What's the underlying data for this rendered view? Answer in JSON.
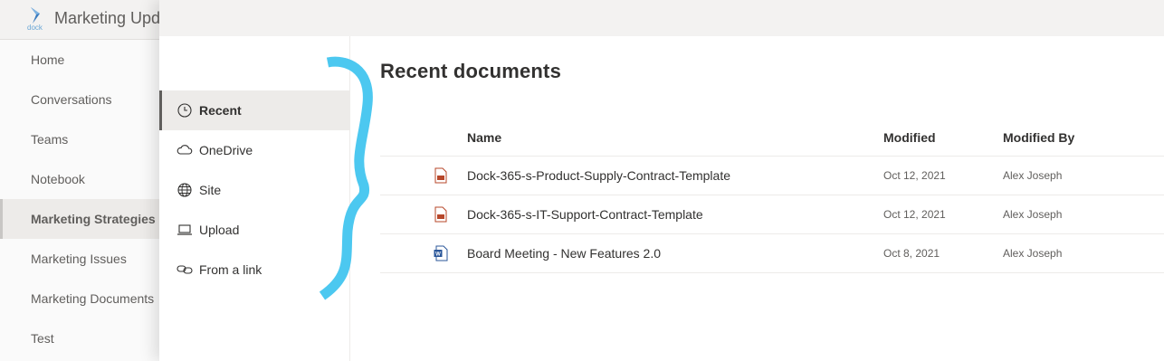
{
  "site": {
    "logo_text": "dock",
    "title": "Marketing Updates",
    "nav_items": [
      {
        "label": "Home"
      },
      {
        "label": "Conversations"
      },
      {
        "label": "Teams"
      },
      {
        "label": "Notebook"
      },
      {
        "label": "Marketing Strategies",
        "selected": true
      },
      {
        "label": "Marketing Issues"
      },
      {
        "label": "Marketing Documents"
      },
      {
        "label": "Test"
      }
    ]
  },
  "picker": {
    "sources": [
      {
        "label": "Recent",
        "icon": "clock-icon",
        "selected": true
      },
      {
        "label": "OneDrive",
        "icon": "cloud-icon"
      },
      {
        "label": "Site",
        "icon": "globe-icon"
      },
      {
        "label": "Upload",
        "icon": "laptop-icon"
      },
      {
        "label": "From a link",
        "icon": "link-icon"
      }
    ],
    "title": "Recent documents",
    "columns": {
      "name": "Name",
      "modified": "Modified",
      "modified_by": "Modified By"
    },
    "rows": [
      {
        "icon": "pdf-file-icon",
        "name": "Dock-365-s-Product-Supply-Contract-Template",
        "modified": "Oct 12, 2021",
        "modified_by": "Alex Joseph"
      },
      {
        "icon": "pdf-file-icon",
        "name": "Dock-365-s-IT-Support-Contract-Template",
        "modified": "Oct 12, 2021",
        "modified_by": "Alex Joseph"
      },
      {
        "icon": "word-file-icon",
        "name": "Board Meeting - New Features 2.0",
        "modified": "Oct 8, 2021",
        "modified_by": "Alex Joseph"
      }
    ]
  },
  "colors": {
    "annotation": "#4cc8f0",
    "word": "#2b579a",
    "pdf": "#b7472a"
  }
}
